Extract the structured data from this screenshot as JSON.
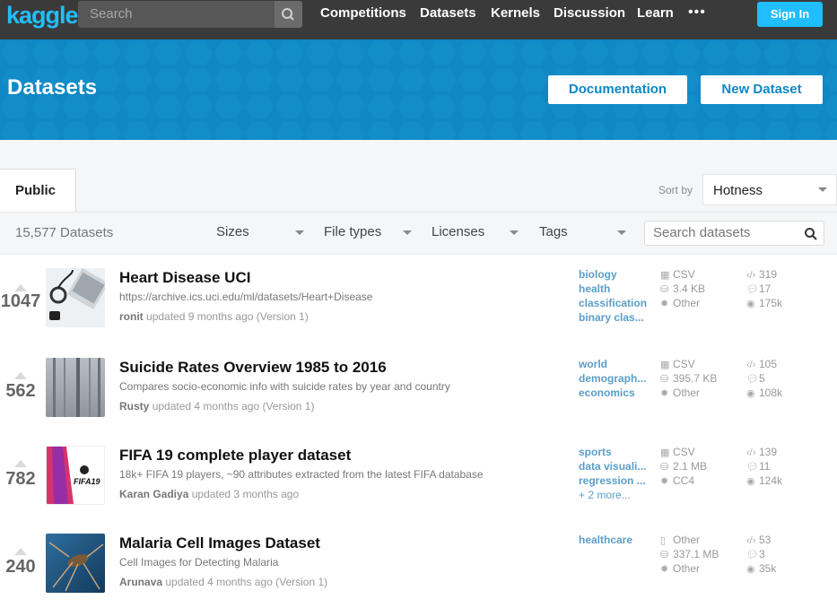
{
  "brand": {
    "logo": "kaggle",
    "accent": "#20beff",
    "banner_color": "#0f88c4"
  },
  "topnav": {
    "search_placeholder": "Search",
    "links": [
      "Competitions",
      "Datasets",
      "Kernels",
      "Discussion",
      "Learn"
    ],
    "more": "•••",
    "signin": "Sign In"
  },
  "banner": {
    "title": "Datasets",
    "documentation": "Documentation",
    "new_dataset": "New Dataset"
  },
  "tabs": {
    "public": "Public"
  },
  "sort": {
    "label": "Sort by",
    "value": "Hotness"
  },
  "filters": {
    "count": "15,577 Datasets",
    "sizes": "Sizes",
    "file_types": "File types",
    "licenses": "Licenses",
    "tags": "Tags",
    "search_placeholder": "Search datasets"
  },
  "datasets": [
    {
      "votes": "1047",
      "title": "Heart Disease UCI",
      "subtitle": "https://archive.ics.uci.edu/ml/datasets/Heart+Disease",
      "author": "ronit",
      "updated": "updated 9 months ago (Version 1)",
      "tags": [
        "biology",
        "health",
        "classification",
        "binary clas..."
      ],
      "file_type": "CSV",
      "size": "3.4 KB",
      "license": "Other",
      "kernels": "319",
      "comments": "17",
      "views": "175k"
    },
    {
      "votes": "562",
      "title": "Suicide Rates Overview 1985 to 2016",
      "subtitle": "Compares socio-economic info with suicide rates by year and country",
      "author": "Rusty",
      "updated": "updated 4 months ago (Version 1)",
      "tags": [
        "world",
        "demograph...",
        "economics"
      ],
      "file_type": "CSV",
      "size": "395.7 KB",
      "license": "Other",
      "kernels": "105",
      "comments": "5",
      "views": "108k"
    },
    {
      "votes": "782",
      "title": "FIFA 19 complete player dataset",
      "subtitle": "18k+ FIFA 19 players, ~90 attributes extracted from the latest FIFA database",
      "author": "Karan Gadiya",
      "updated": "updated 3 months ago",
      "tags": [
        "sports",
        "data visuali...",
        "regression ...",
        "+ 2 more..."
      ],
      "thumb_text": "FIFA19",
      "file_type": "CSV",
      "size": "2.1 MB",
      "license": "CC4",
      "kernels": "139",
      "comments": "11",
      "views": "124k"
    },
    {
      "votes": "240",
      "title": "Malaria Cell Images Dataset",
      "subtitle": "Cell Images for Detecting Malaria",
      "author": "Arunava",
      "updated": "updated 4 months ago (Version 1)",
      "tags": [
        "healthcare"
      ],
      "file_type": "Other",
      "size": "337.1 MB",
      "license": "Other",
      "kernels": "53",
      "comments": "3",
      "views": "35k"
    }
  ]
}
